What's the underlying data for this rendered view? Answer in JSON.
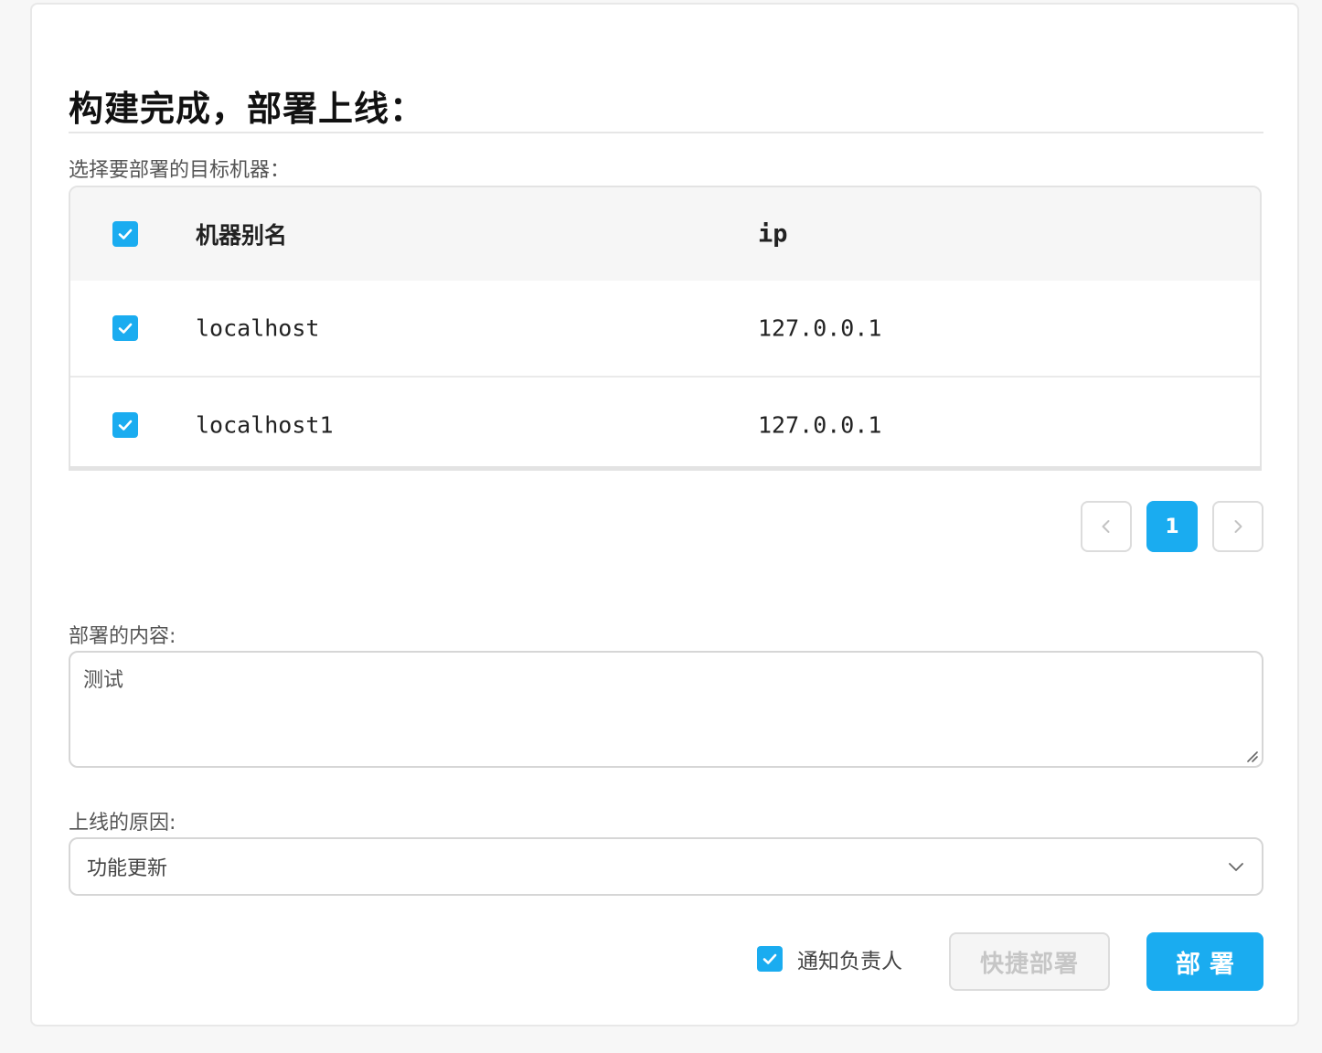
{
  "header": {
    "title": "构建完成，部署上线："
  },
  "machines": {
    "label": "选择要部署的目标机器：",
    "columns": {
      "name": "机器别名",
      "ip": "ip"
    },
    "select_all_checked": true,
    "rows": [
      {
        "name": "localhost",
        "ip": "127.0.0.1",
        "checked": true
      },
      {
        "name": "localhost1",
        "ip": "127.0.0.1",
        "checked": true
      }
    ]
  },
  "pagination": {
    "prev_icon": "chevron-left-icon",
    "current_page": "1",
    "next_icon": "chevron-right-icon"
  },
  "content": {
    "label": "部署的内容:",
    "value": "测试"
  },
  "reason": {
    "label": "上线的原因:",
    "selected": "功能更新",
    "icon": "chevron-down-icon"
  },
  "footer": {
    "notify_label": "通知负责人",
    "notify_checked": true,
    "quick_deploy_label": "快捷部署",
    "deploy_label": "部署"
  },
  "colors": {
    "accent": "#1aacf0",
    "disabled_text": "#c6c6c6"
  }
}
